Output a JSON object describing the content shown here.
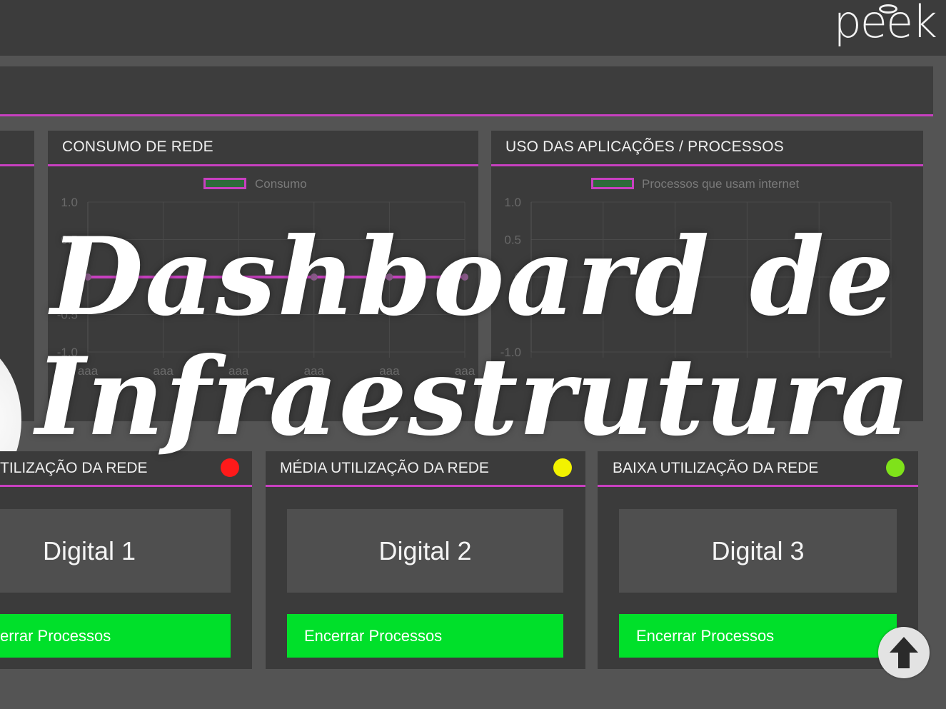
{
  "logo": {
    "text": "peek"
  },
  "panels": {
    "network": {
      "title": "CONSUMO DE REDE",
      "legend": "Consumo"
    },
    "apps": {
      "title": "USO DAS APLICAÇÕES / PROCESSOS",
      "legend": "Processos que usam internet"
    }
  },
  "chart_data": [
    {
      "type": "line",
      "title": "CONSUMO DE REDE",
      "x": [
        "aaa",
        "aaa",
        "aaa",
        "aaa",
        "aaa",
        "aaa"
      ],
      "series": [
        {
          "name": "Consumo",
          "values": [
            0,
            0,
            0,
            0,
            0,
            0
          ]
        }
      ],
      "yticks": [
        "1.0",
        "0.5",
        "0",
        "-0.5",
        "-1.0"
      ],
      "ylim": [
        -1.0,
        1.0
      ],
      "grid": true,
      "legend": "top-center",
      "colors": {
        "line": "#c840c0",
        "fill": "#2d6b3a"
      }
    },
    {
      "type": "line",
      "title": "USO DAS APLICAÇÕES / PROCESSOS",
      "series": [
        {
          "name": "Processos que usam internet",
          "values": []
        }
      ],
      "yticks": [
        "1.0",
        "0.5",
        "0",
        "-1.0"
      ],
      "ylim": [
        -1.0,
        1.0
      ],
      "grid": true,
      "legend": "top-center",
      "colors": {
        "fill": "#2d6b3a"
      }
    }
  ],
  "cards": [
    {
      "title": "TILIZAÇÃO DA REDE",
      "status_color": "#ff1a1a",
      "digital": "Digital 1",
      "button": "errar Processos"
    },
    {
      "title": "MÉDIA UTILIZAÇÃO DA REDE",
      "status_color": "#f2f200",
      "digital": "Digital 2",
      "button": "Encerrar Processos"
    },
    {
      "title": "BAIXA UTILIZAÇÃO DA REDE",
      "status_color": "#7fe21a",
      "digital": "Digital 3",
      "button": "Encerrar Processos"
    }
  ],
  "headline": {
    "line1": "Dashboard de",
    "line2": "Infraestrutura"
  },
  "icons": {
    "scroll_top": "arrow-up-icon",
    "gauge": "gauge-icon"
  },
  "colors": {
    "accent": "#c840c0",
    "button": "#00e02a",
    "panel": "#3b3b3b"
  }
}
